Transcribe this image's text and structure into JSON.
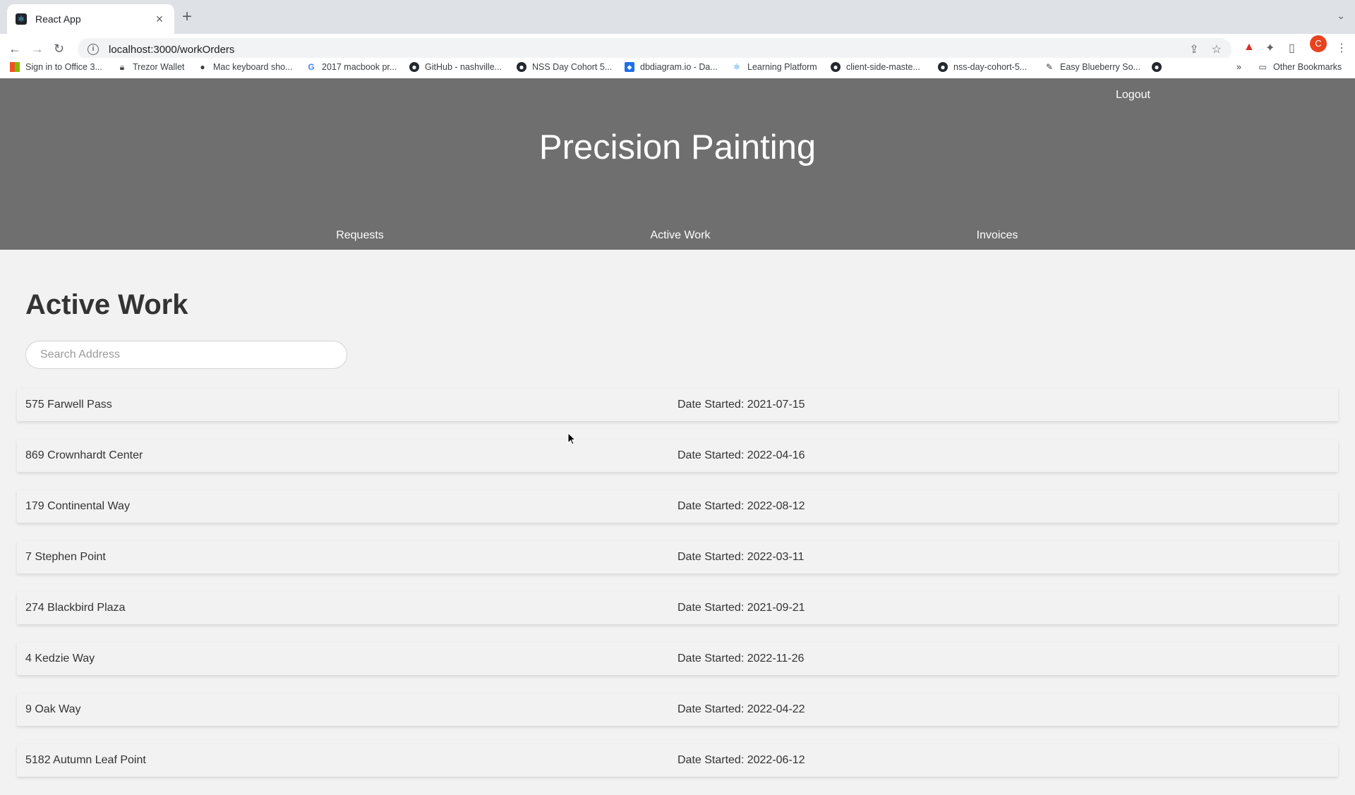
{
  "browser": {
    "tab_title": "React App",
    "url": "localhost:3000/workOrders",
    "profile_initial": "C",
    "bookmarks": [
      "Sign in to Office 3...",
      "Trezor Wallet",
      "Mac keyboard sho...",
      "2017 macbook pr...",
      "GitHub - nashville...",
      "NSS Day Cohort 5...",
      "dbdiagram.io - Da...",
      "Learning Platform",
      "client-side-maste...",
      "nss-day-cohort-5...",
      "Easy Blueberry So..."
    ],
    "overflow": "»",
    "other_bookmarks": "Other Bookmarks"
  },
  "header": {
    "logout": "Logout",
    "title": "Precision Painting",
    "nav": [
      "Requests",
      "Active Work",
      "Invoices"
    ]
  },
  "main": {
    "title": "Active Work",
    "search_placeholder": "Search Address",
    "work_orders": [
      {
        "address": "575 Farwell Pass",
        "date": "Date Started: 2021-07-15"
      },
      {
        "address": "869 Crownhardt Center",
        "date": "Date Started: 2022-04-16"
      },
      {
        "address": "179 Continental Way",
        "date": "Date Started: 2022-08-12"
      },
      {
        "address": "7 Stephen Point",
        "date": "Date Started: 2022-03-11"
      },
      {
        "address": "274 Blackbird Plaza",
        "date": "Date Started: 2021-09-21"
      },
      {
        "address": "4 Kedzie Way",
        "date": "Date Started: 2022-11-26"
      },
      {
        "address": "9 Oak Way",
        "date": "Date Started: 2022-04-22"
      },
      {
        "address": "5182 Autumn Leaf Point",
        "date": "Date Started: 2022-06-12"
      }
    ]
  }
}
